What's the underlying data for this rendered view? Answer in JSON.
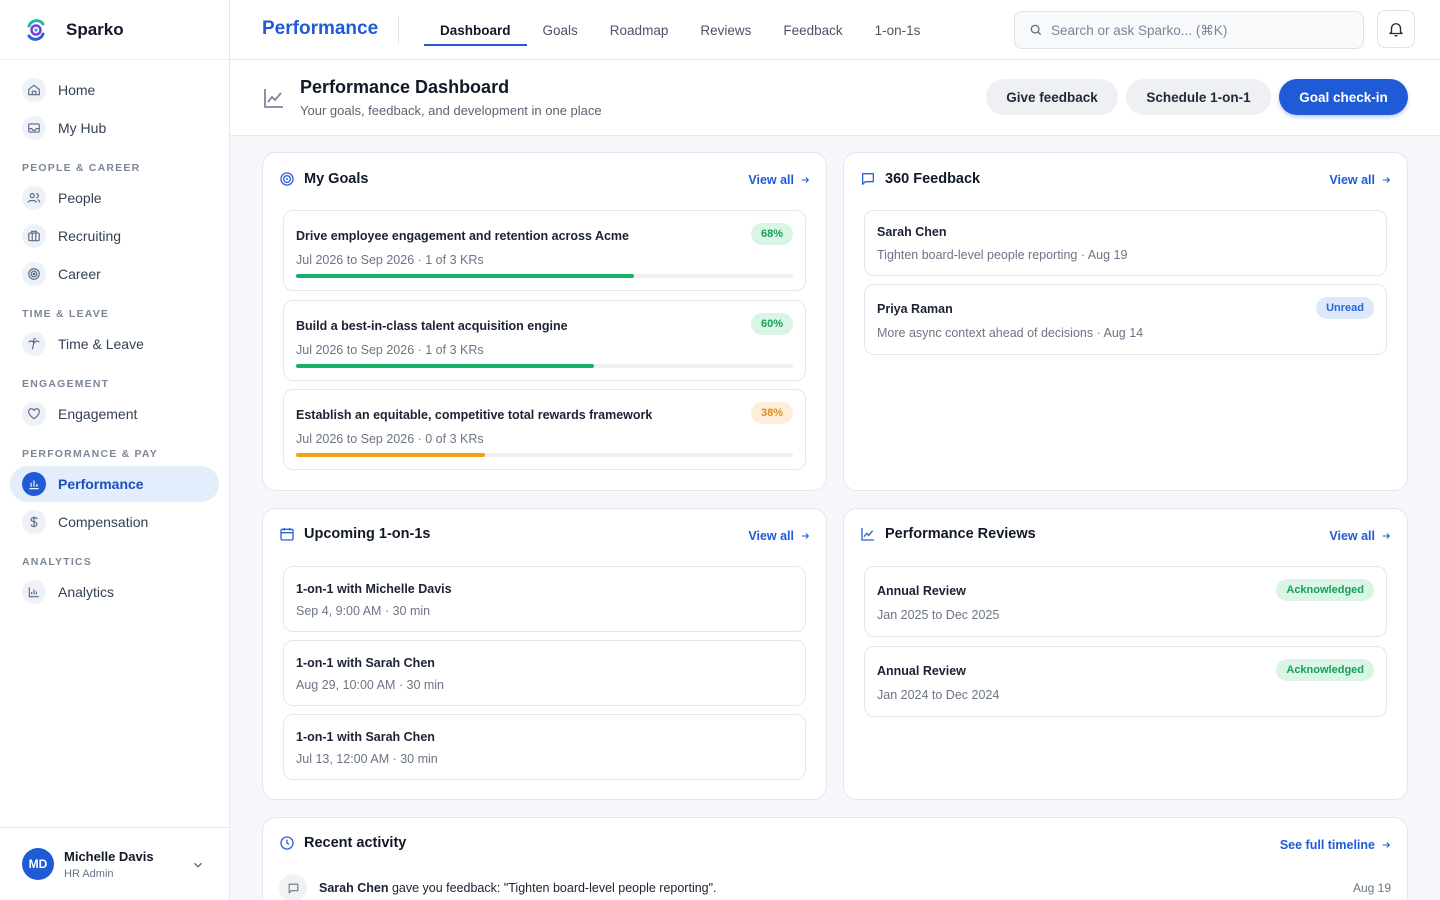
{
  "app": {
    "name": "Sparko"
  },
  "sidebar": {
    "items": [
      {
        "label": "Home",
        "icon": "home-icon"
      },
      {
        "label": "My Hub",
        "icon": "inbox-icon"
      }
    ],
    "sections": [
      {
        "title": "PEOPLE & CAREER",
        "items": [
          {
            "label": "People",
            "icon": "people-icon"
          },
          {
            "label": "Recruiting",
            "icon": "briefcase-icon"
          },
          {
            "label": "Career",
            "icon": "target-icon"
          }
        ]
      },
      {
        "title": "TIME & LEAVE",
        "items": [
          {
            "label": "Time & Leave",
            "icon": "palm-tree-icon"
          }
        ]
      },
      {
        "title": "ENGAGEMENT",
        "items": [
          {
            "label": "Engagement",
            "icon": "heart-icon"
          }
        ]
      },
      {
        "title": "PERFORMANCE & PAY",
        "items": [
          {
            "label": "Performance",
            "icon": "bar-chart-icon",
            "active": true
          },
          {
            "label": "Compensation",
            "icon": "dollar-icon"
          }
        ]
      },
      {
        "title": "ANALYTICS",
        "items": [
          {
            "label": "Analytics",
            "icon": "analytics-icon"
          }
        ]
      }
    ]
  },
  "user": {
    "initials": "MD",
    "name": "Michelle Davis",
    "role": "HR Admin"
  },
  "topbar": {
    "title": "Performance",
    "tabs": [
      "Dashboard",
      "Goals",
      "Roadmap",
      "Reviews",
      "Feedback",
      "1-on-1s"
    ],
    "active_tab": "Dashboard",
    "search_placeholder": "Search or ask Sparko... (⌘K)"
  },
  "page": {
    "title": "Performance Dashboard",
    "subtitle": "Your goals, feedback, and development in one place",
    "buttons": {
      "feedback": "Give feedback",
      "schedule": "Schedule 1-on-1",
      "checkin": "Goal check-in"
    }
  },
  "goals": {
    "title": "My Goals",
    "view_all": "View all",
    "items": [
      {
        "title": "Drive employee engagement and retention across Acme",
        "meta": "Jul 2026 to Sep 2026 · 1 of 3 KRs",
        "percent_label": "68%",
        "progress": 0.68,
        "color": "#17b26a"
      },
      {
        "title": "Build a best-in-class talent acquisition engine",
        "meta": "Jul 2026 to Sep 2026 · 1 of 3 KRs",
        "percent_label": "60%",
        "progress": 0.6,
        "color": "#17b26a"
      },
      {
        "title": "Establish an equitable, competitive total rewards framework",
        "meta": "Jul 2026 to Sep 2026 · 0 of 3 KRs",
        "percent_label": "38%",
        "progress": 0.38,
        "color": "#f4a11a"
      }
    ]
  },
  "feedback": {
    "title": "360 Feedback",
    "view_all": "View all",
    "items": [
      {
        "name": "Sarah Chen",
        "meta": "Tighten board-level people reporting · Aug 19",
        "badge": ""
      },
      {
        "name": "Priya Raman",
        "meta": "More async context ahead of decisions · Aug 14",
        "badge": "Unread"
      }
    ]
  },
  "oneonones": {
    "title": "Upcoming 1-on-1s",
    "view_all": "View all",
    "items": [
      {
        "title": "1-on-1 with Michelle Davis",
        "meta": "Sep 4, 9:00 AM · 30 min"
      },
      {
        "title": "1-on-1 with Sarah Chen",
        "meta": "Aug 29, 10:00 AM · 30 min"
      },
      {
        "title": "1-on-1 with Sarah Chen",
        "meta": "Jul 13, 12:00 AM · 30 min"
      }
    ]
  },
  "reviews": {
    "title": "Performance Reviews",
    "view_all": "View all",
    "items": [
      {
        "title": "Annual Review",
        "meta": "Jan 2025 to Dec 2025",
        "badge": "Acknowledged"
      },
      {
        "title": "Annual Review",
        "meta": "Jan 2024 to Dec 2024",
        "badge": "Acknowledged"
      }
    ]
  },
  "activity": {
    "title": "Recent activity",
    "link": "See full timeline",
    "items": [
      {
        "actor": "Sarah Chen",
        "text": " gave you feedback: \"Tighten board-level people reporting\".",
        "date": "Aug 19"
      }
    ]
  },
  "colors": {
    "accent": "#1f5bd6",
    "success": "#17b26a",
    "warning": "#f4a11a"
  }
}
